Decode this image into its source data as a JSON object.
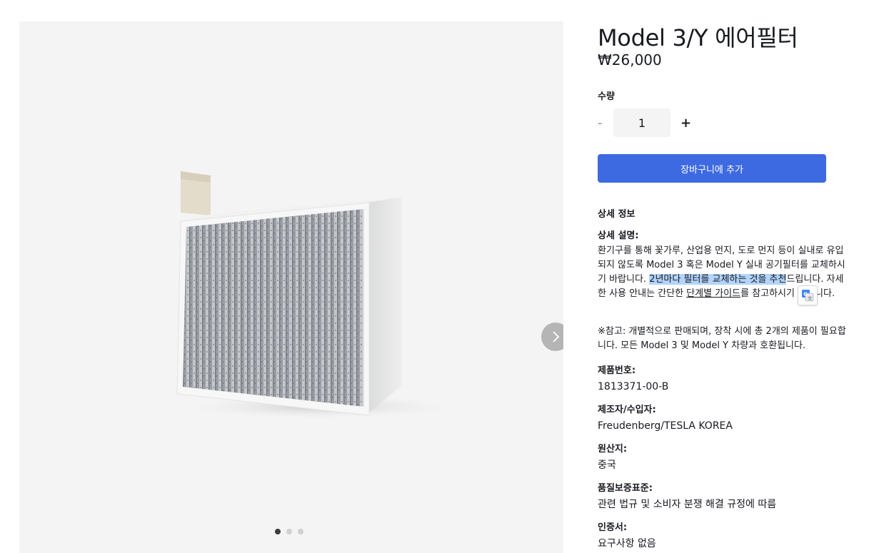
{
  "product": {
    "title": "Model 3/Y 에어필터",
    "price": "₩26,000",
    "image_icon": "cabin-air-filter-image"
  },
  "gallery": {
    "next_icon": "chevron-right-icon",
    "slide_count": 3,
    "active_slide": 1
  },
  "quantity": {
    "label": "수량",
    "minus": "-",
    "value": "1",
    "plus": "+"
  },
  "cart": {
    "add_label": "장바구니에 추가"
  },
  "details": {
    "section_title": "상세 정보",
    "description": {
      "label": "상세 설명:",
      "text_1": "환기구를 통해 꽃가루, 산업용 먼지, 도로 먼지 등이 실내로 유입되지 않도록 Model 3 혹은 Model Y 실내 공기필터를 교체하시기 바랍니다. ",
      "highlighted": "2년마다 필터를 교체하는 것을 추천",
      "text_2": "드립니다. 자세한 사용 안내는 간단한 ",
      "link": "단계별 가이드",
      "text_3": "를 참고하시기 바랍니다."
    },
    "note": "※참고: 개별적으로 판매되며, 장착 시에 총 2개의 제품이 필요합니다. 모든 Model 3 및 Model Y 차량과 호환됩니다.",
    "specs": [
      {
        "label": "제품번호:",
        "value": "1813371-00-B"
      },
      {
        "label": "제조자/수입자:",
        "value": "Freudenberg/TESLA KOREA"
      },
      {
        "label": "원산지:",
        "value": "중국"
      },
      {
        "label": "품질보증표준:",
        "value": "관련 법규 및 소비자 분쟁 해결 규정에 따름"
      },
      {
        "label": "인증서:",
        "value": "요구사항 없음"
      }
    ]
  },
  "colors": {
    "accent": "#3e6ae1",
    "text": "#171a20",
    "gallery_bg": "#f4f4f4",
    "selection": "#b3d4fc"
  }
}
